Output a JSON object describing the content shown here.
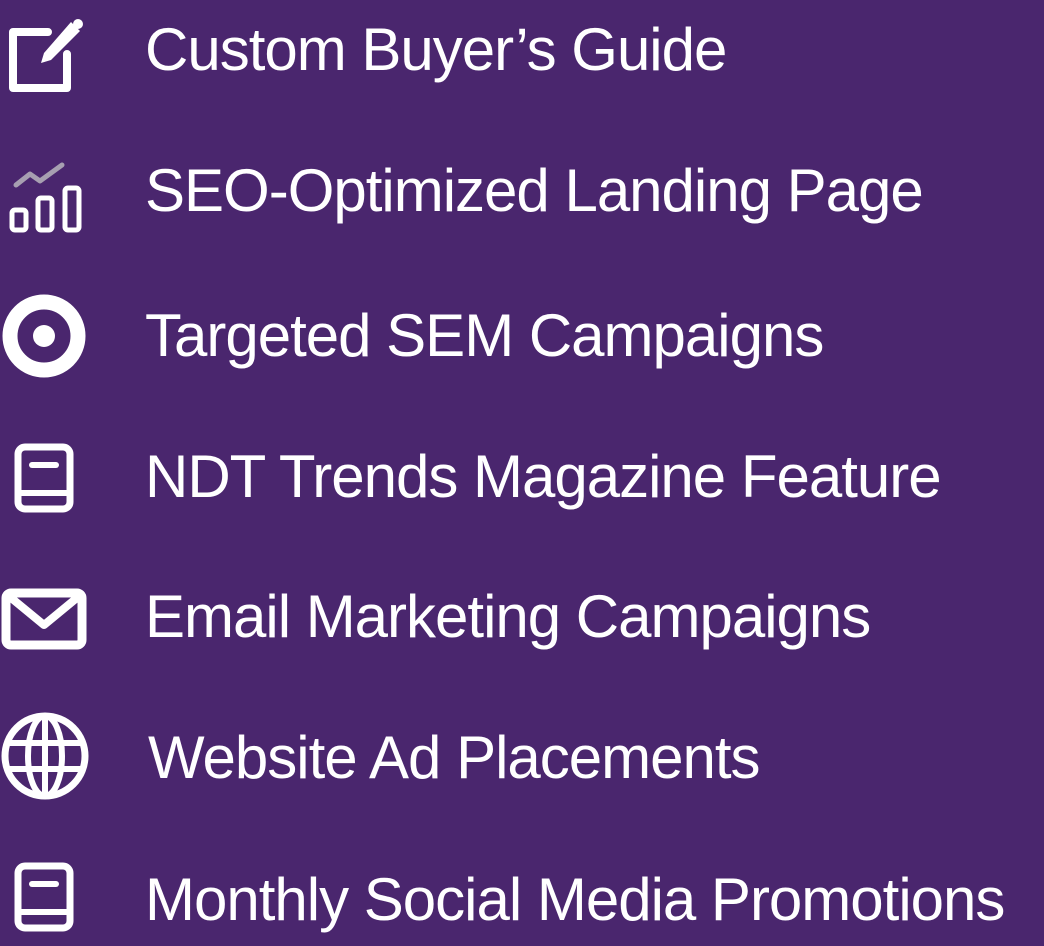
{
  "colors": {
    "background": "#4a266e",
    "foreground": "#ffffff",
    "icon_accent": "#a79fb1"
  },
  "features": [
    {
      "icon": "edit-square-icon",
      "label": "Custom Buyer’s Guide"
    },
    {
      "icon": "bar-chart-trend-icon",
      "label": "SEO-Optimized Landing Page"
    },
    {
      "icon": "target-icon",
      "label": "Targeted SEM Campaigns"
    },
    {
      "icon": "book-icon",
      "label": "NDT Trends Magazine Feature"
    },
    {
      "icon": "envelope-icon",
      "label": "Email Marketing Campaigns"
    },
    {
      "icon": "globe-icon",
      "label": "Website Ad Placements"
    },
    {
      "icon": "book-icon",
      "label": "Monthly Social Media Promotions"
    }
  ]
}
